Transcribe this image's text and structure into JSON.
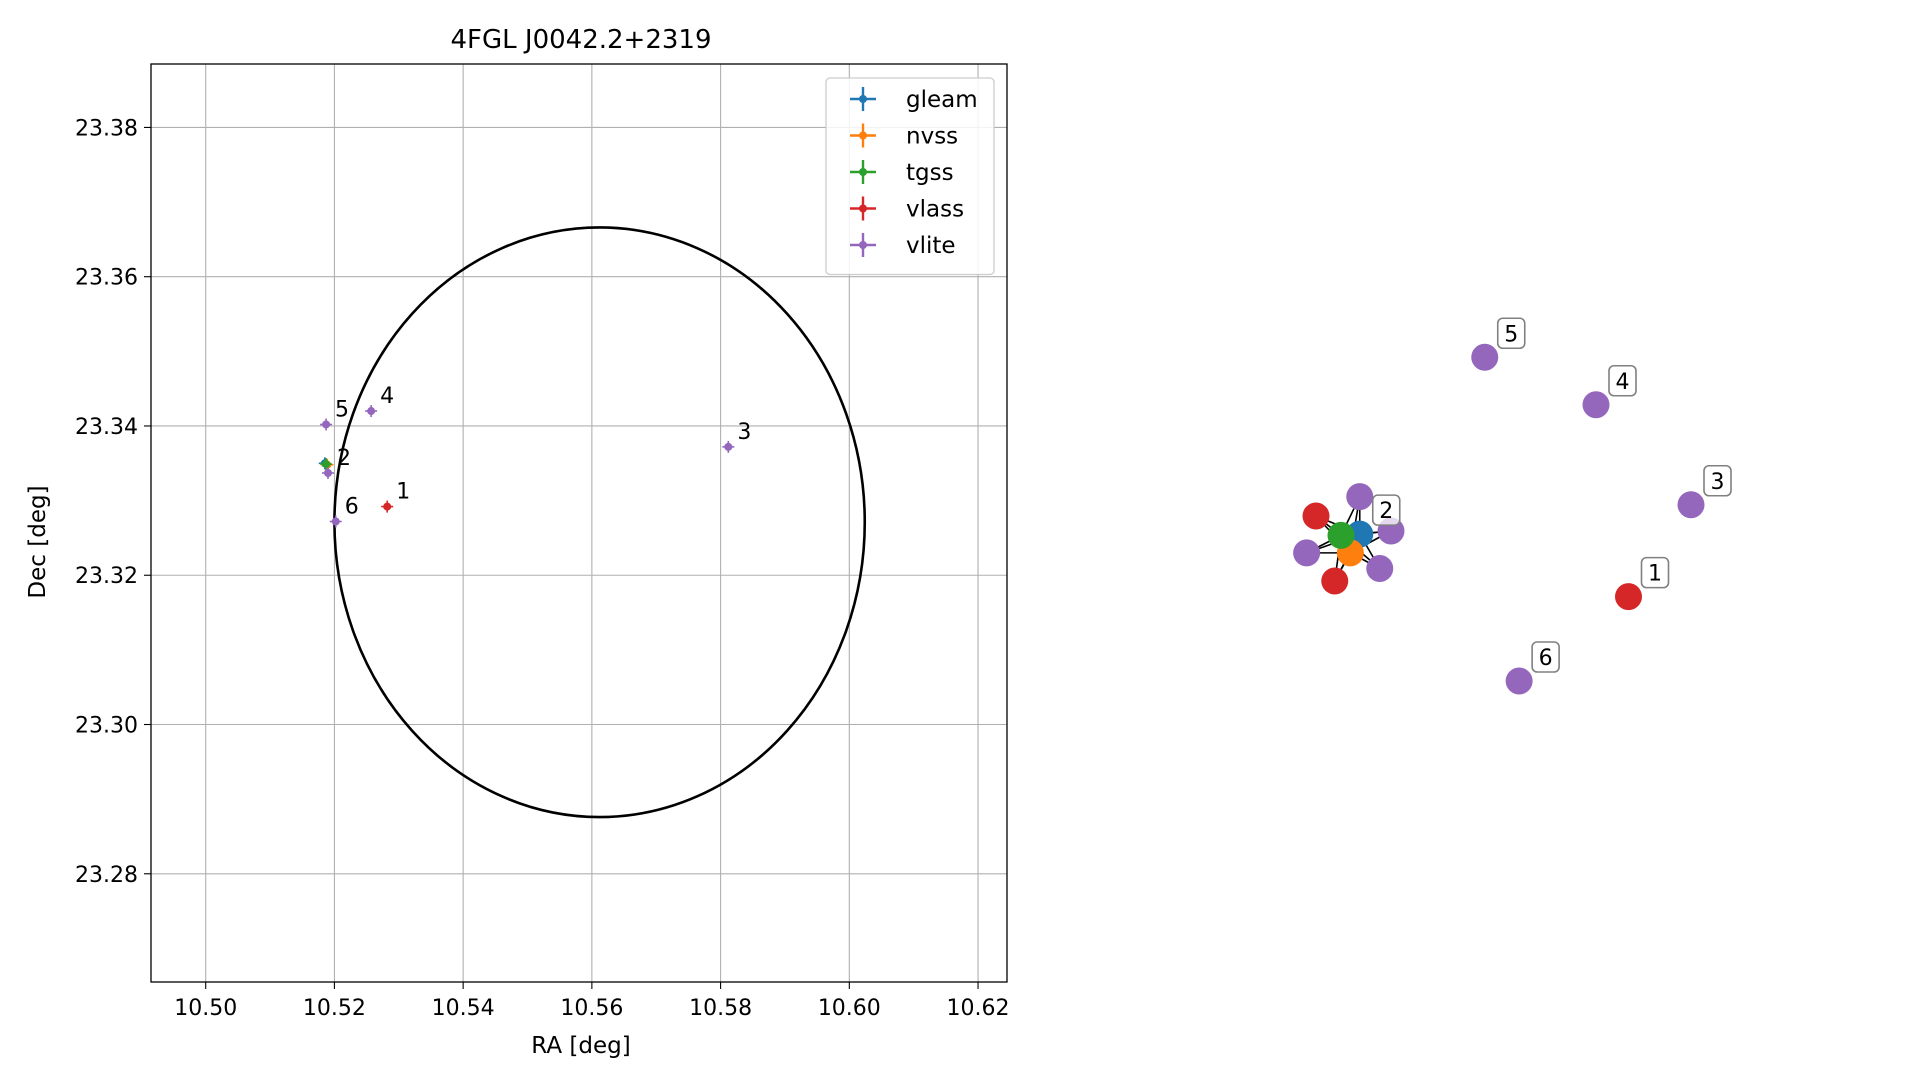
{
  "chart_data": [
    {
      "type": "scatter",
      "title": "4FGL J0042.2+2319",
      "xlabel": "RA [deg]",
      "ylabel": "Dec [deg]",
      "xlim": [
        10.4915,
        10.6245
      ],
      "ylim": [
        23.2655,
        23.3885
      ],
      "xticks": [
        "10.50",
        "10.52",
        "10.54",
        "10.56",
        "10.58",
        "10.60",
        "10.62"
      ],
      "yticks": [
        "23.28",
        "23.30",
        "23.32",
        "23.34",
        "23.36",
        "23.38"
      ],
      "grid": true,
      "legend": "top-right",
      "series": [
        {
          "name": "gleam",
          "color": "#1f77b4",
          "points": [
            {
              "x": 10.5185,
              "y": 23.335
            }
          ]
        },
        {
          "name": "nvss",
          "color": "#ff7f0e",
          "points": [
            {
              "x": 10.5189,
              "y": 23.3348
            }
          ]
        },
        {
          "name": "tgss",
          "color": "#2ca02c",
          "points": [
            {
              "x": 10.5187,
              "y": 23.3349
            }
          ]
        },
        {
          "name": "vlass",
          "color": "#d62728",
          "points": [
            {
              "x": 10.5282,
              "y": 23.3292,
              "label": "1"
            }
          ]
        },
        {
          "name": "vlite",
          "color": "#9467bd",
          "points": [
            {
              "x": 10.519,
              "y": 23.3337,
              "label": "2"
            },
            {
              "x": 10.5812,
              "y": 23.3372,
              "label": "3"
            },
            {
              "x": 10.5257,
              "y": 23.342,
              "label": "4"
            },
            {
              "x": 10.5187,
              "y": 23.3402,
              "label": "5"
            },
            {
              "x": 10.5202,
              "y": 23.3272,
              "label": "6"
            }
          ]
        }
      ],
      "ellipse": {
        "ra_center": 10.5612,
        "dec_center": 23.3271,
        "ra_semi_axis": 0.0412,
        "dec_semi_axis": 0.0395,
        "color": "#000000"
      }
    },
    {
      "type": "graph",
      "nodes": [
        {
          "id": "c_gleam",
          "color": "#1f77b4",
          "x": 0.3,
          "y": -0.05
        },
        {
          "id": "c_nvss",
          "color": "#ff7f0e",
          "x": 0.15,
          "y": -0.35
        },
        {
          "id": "c_tgss",
          "color": "#2ca02c",
          "x": 0.0,
          "y": -0.07
        },
        {
          "id": "c_vlass_a",
          "color": "#d62728",
          "x": -0.4,
          "y": 0.24
        },
        {
          "id": "c_vlass_b",
          "color": "#d62728",
          "x": -0.1,
          "y": -0.8
        },
        {
          "id": "c_vlite_a",
          "color": "#9467bd",
          "x": 0.3,
          "y": 0.55
        },
        {
          "id": "c_vlite_b",
          "color": "#9467bd",
          "x": 0.8,
          "y": 0.0
        },
        {
          "id": "c_vlite_c",
          "color": "#9467bd",
          "x": -0.55,
          "y": -0.35
        },
        {
          "id": "c_vlite_d",
          "color": "#9467bd",
          "x": 0.62,
          "y": -0.6
        },
        {
          "id": "n1",
          "color": "#d62728",
          "x": 4.6,
          "y": -1.05,
          "label": "1"
        },
        {
          "id": "n2",
          "color": "#1f77b4",
          "x": 0.3,
          "y": -0.05,
          "label": "2"
        },
        {
          "id": "n3",
          "color": "#9467bd",
          "x": 5.6,
          "y": 0.42,
          "label": "3"
        },
        {
          "id": "n4",
          "color": "#9467bd",
          "x": 4.08,
          "y": 2.02,
          "label": "4"
        },
        {
          "id": "n5",
          "color": "#9467bd",
          "x": 2.3,
          "y": 2.78,
          "label": "5"
        },
        {
          "id": "n6",
          "color": "#9467bd",
          "x": 2.85,
          "y": -2.4,
          "label": "6"
        }
      ],
      "edges": [
        [
          "c_tgss",
          "c_gleam"
        ],
        [
          "c_tgss",
          "c_nvss"
        ],
        [
          "c_tgss",
          "c_vlass_a"
        ],
        [
          "c_tgss",
          "c_vlass_b"
        ],
        [
          "c_tgss",
          "c_vlite_a"
        ],
        [
          "c_tgss",
          "c_vlite_b"
        ],
        [
          "c_tgss",
          "c_vlite_c"
        ],
        [
          "c_tgss",
          "c_vlite_d"
        ],
        [
          "c_gleam",
          "c_nvss"
        ],
        [
          "c_gleam",
          "c_vlass_a"
        ],
        [
          "c_gleam",
          "c_vlass_b"
        ],
        [
          "c_gleam",
          "c_vlite_a"
        ],
        [
          "c_gleam",
          "c_vlite_b"
        ],
        [
          "c_gleam",
          "c_vlite_c"
        ],
        [
          "c_gleam",
          "c_vlite_d"
        ],
        [
          "c_nvss",
          "c_vlass_a"
        ],
        [
          "c_nvss",
          "c_vlass_b"
        ],
        [
          "c_nvss",
          "c_vlite_a"
        ],
        [
          "c_nvss",
          "c_vlite_b"
        ],
        [
          "c_nvss",
          "c_vlite_c"
        ],
        [
          "c_nvss",
          "c_vlite_d"
        ]
      ]
    }
  ]
}
